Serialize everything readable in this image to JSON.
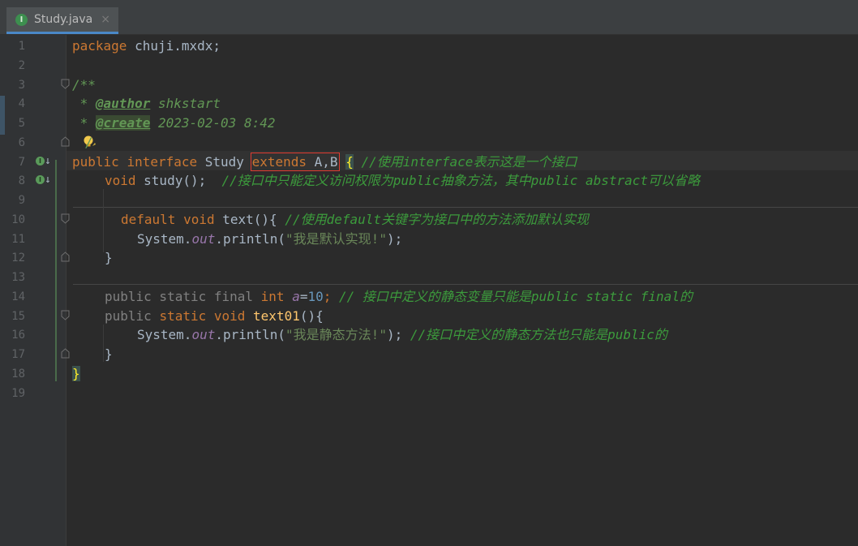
{
  "tab": {
    "icon_letter": "I",
    "title": "Study.java",
    "close": "×"
  },
  "gutter": {
    "line_numbers": [
      "1",
      "2",
      "3",
      "4",
      "5",
      "6",
      "7",
      "8",
      "9",
      "10",
      "11",
      "12",
      "13",
      "14",
      "15",
      "16",
      "17",
      "18",
      "19"
    ]
  },
  "code": {
    "l1": {
      "kw": "package",
      "rest": " chuji.mxdx;"
    },
    "l3": {
      "text": "/**"
    },
    "l4": {
      "star": " * ",
      "tag": "@author",
      "val": " shkstart"
    },
    "l5": {
      "star": " * ",
      "tag": "@create",
      "val": " 2023-02-03 8:42"
    },
    "l6": {
      "text": "/"
    },
    "l7": {
      "kw1": "public",
      "kw2": "interface",
      "name": " Study ",
      "ext_kw": "extends",
      "ext_rest": " A,B",
      "brace": "{",
      "comment": " //使用interface表示这是一个接口"
    },
    "l8": {
      "kw": "void",
      "rest": " study();  ",
      "comment": "//接口中只能定义访问权限为public抽象方法，其中public abstract可以省略"
    },
    "l10": {
      "kw1": "default",
      "kw2": "void",
      "rest": " text(){ ",
      "comment": "//使用default关键字为接口中的方法添加默认实现"
    },
    "l11": {
      "a": "System.",
      "field": "out",
      "b": ".println(",
      "str": "\"我是默认实现!\"",
      "c": ");"
    },
    "l12": {
      "text": "}"
    },
    "l14": {
      "g1": "public static final ",
      "kw": "int",
      "sp": " ",
      "var": "a",
      "eq": "=",
      "num": "10",
      "semi": ";",
      "comment": " // 接口中定义的静态变量只能是public static final的"
    },
    "l15": {
      "g": "public ",
      "kw1": "static",
      "kw2": "void",
      "fn": " text01",
      "rest": "(){"
    },
    "l16": {
      "a": "System.",
      "field": "out",
      "b": ".println(",
      "str": "\"我是静态方法!\"",
      "c": ");",
      "comment": " //接口中定义的静态方法也只能是public的"
    },
    "l17": {
      "text": "}"
    },
    "l18": {
      "text": "}"
    }
  }
}
